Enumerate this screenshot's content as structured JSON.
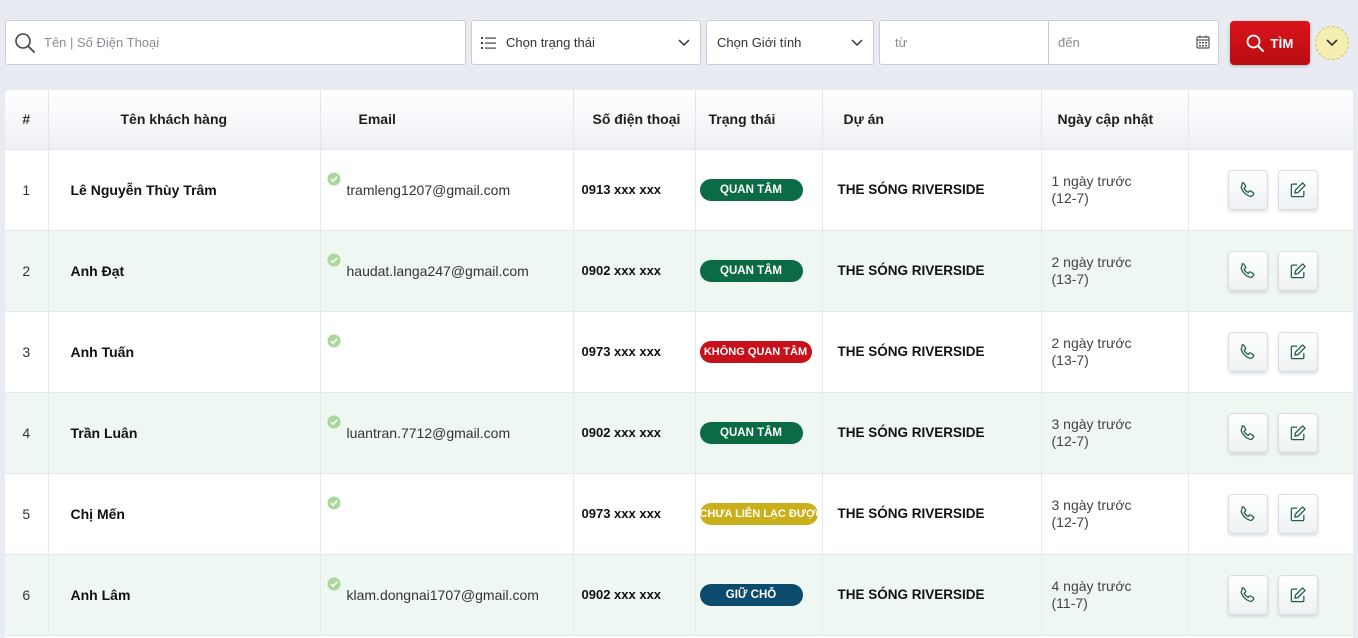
{
  "filters": {
    "search_placeholder": "Tên | Số Điện Thoại",
    "status_label": "Chọn trạng thái",
    "gender_label": "Chọn Giới tính",
    "date_from_placeholder": "từ",
    "date_to_placeholder": "đến",
    "search_button": "TÌM"
  },
  "table": {
    "headers": {
      "index": "#",
      "name": "Tên khách hàng",
      "email": "Email",
      "phone": "Số điện thoại",
      "status": "Trạng thái",
      "project": "Dự án",
      "updated": "Ngày cập nhật"
    },
    "rows": [
      {
        "index": "1",
        "name": "Lê Nguyễn Thùy Trâm",
        "email": "tramleng1207@gmail.com",
        "phone": "0913 xxx xxx",
        "status": "QUAN TÂM",
        "status_color": "#0b6b45",
        "project": "THE SÓNG RIVERSIDE",
        "updated_rel": "1 ngày trước",
        "updated_date": "(12-7)"
      },
      {
        "index": "2",
        "name": "Anh Đạt",
        "email": "haudat.langa247@gmail.com",
        "phone": "0902 xxx xxx",
        "status": "QUAN TÂM",
        "status_color": "#0b6b45",
        "project": "THE SÓNG RIVERSIDE",
        "updated_rel": "2 ngày trước",
        "updated_date": "(13-7)"
      },
      {
        "index": "3",
        "name": "Anh Tuấn",
        "email": "",
        "phone": "0973 xxx xxx",
        "status": "KHÔNG QUAN TÂM",
        "status_color": "#c8101a",
        "project": "THE SÓNG RIVERSIDE",
        "updated_rel": "2 ngày trước",
        "updated_date": "(13-7)"
      },
      {
        "index": "4",
        "name": "Trần Luân",
        "email": "luantran.7712@gmail.com",
        "phone": "0902 xxx xxx",
        "status": "QUAN TÂM",
        "status_color": "#0b6b45",
        "project": "THE SÓNG RIVERSIDE",
        "updated_rel": "3 ngày trước",
        "updated_date": "(12-7)"
      },
      {
        "index": "5",
        "name": "Chị Mến",
        "email": "",
        "phone": "0973 xxx xxx",
        "status": "CHƯA LIÊN LẠC ĐƯỢC",
        "status_color": "#c9b01a",
        "project": "THE SÓNG RIVERSIDE",
        "updated_rel": "3 ngày trước",
        "updated_date": "(12-7)"
      },
      {
        "index": "6",
        "name": "Anh Lâm",
        "email": "klam.dongnai1707@gmail.com",
        "phone": "0902 xxx xxx",
        "status": "GIỮ CHỖ",
        "status_color": "#0c4a6e",
        "project": "THE SÓNG RIVERSIDE",
        "updated_rel": "4 ngày trước",
        "updated_date": "(11-7)"
      }
    ]
  },
  "icons": {
    "search": "search-icon",
    "list": "list-icon",
    "chevron": "chevron-down-icon",
    "calendar": "calendar-icon",
    "verified": "check-circle-icon",
    "call": "phone-icon",
    "edit": "edit-icon"
  }
}
